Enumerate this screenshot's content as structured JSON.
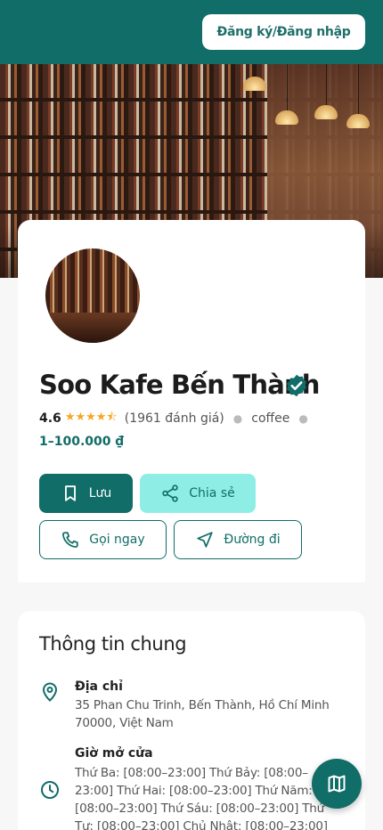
{
  "header": {
    "login_label": "Đăng ký/Đăng nhập"
  },
  "place": {
    "name": "Soo Kafe Bến Thành",
    "rating": "4.6",
    "rating_value": 4.6,
    "review_count": "(1961 đánh giá)",
    "category": "coffee",
    "price_range": "1–100.000 ₫"
  },
  "actions": {
    "save": "Lưu",
    "share": "Chia sẻ",
    "call": "Gọi ngay",
    "directions": "Đường đi"
  },
  "info": {
    "title": "Thông tin chung",
    "address_label": "Địa chỉ",
    "address": "35 Phan Chu Trinh, Bến Thành, Hồ Chí Minh 70000, Việt Nam",
    "hours_label": "Giờ mở cửa",
    "hours": "Thứ Ba: [08:00–23:00] Thứ Bảy: [08:00–23:00] Thứ Hai: [08:00–23:00] Thứ Năm: [08:00–23:00] Thứ Sáu: [08:00–23:00] Thứ Tư: [08:00–23:00] Chủ Nhật: [08:00–23:00]"
  },
  "icons": {
    "save": "bookmark-icon",
    "share": "share-icon",
    "call": "phone-icon",
    "directions": "navigation-icon",
    "address": "location-pin-icon",
    "hours": "clock-icon",
    "map": "map-icon",
    "verified": "verified-badge-icon"
  },
  "colors": {
    "primary": "#106d68",
    "share_bg": "#8eeee6",
    "star": "#f5a623"
  }
}
